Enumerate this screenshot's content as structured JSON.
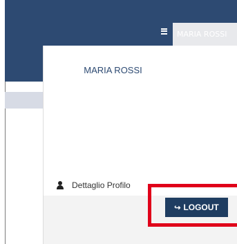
{
  "header": {
    "menu_icon": "hamburger-icon",
    "user_tab_label": "MARIA ROSSI"
  },
  "dropdown": {
    "user_name": "MARIA ROSSI",
    "profile_link_icon": "user-icon",
    "profile_link_label": "Dettaglio Profilo",
    "logout_icon": "sign-out-icon",
    "logout_label": "LOGOUT"
  },
  "colors": {
    "topbar": "#2d4a72",
    "logout_button": "#1f3d61",
    "highlight": "#e0001a"
  }
}
